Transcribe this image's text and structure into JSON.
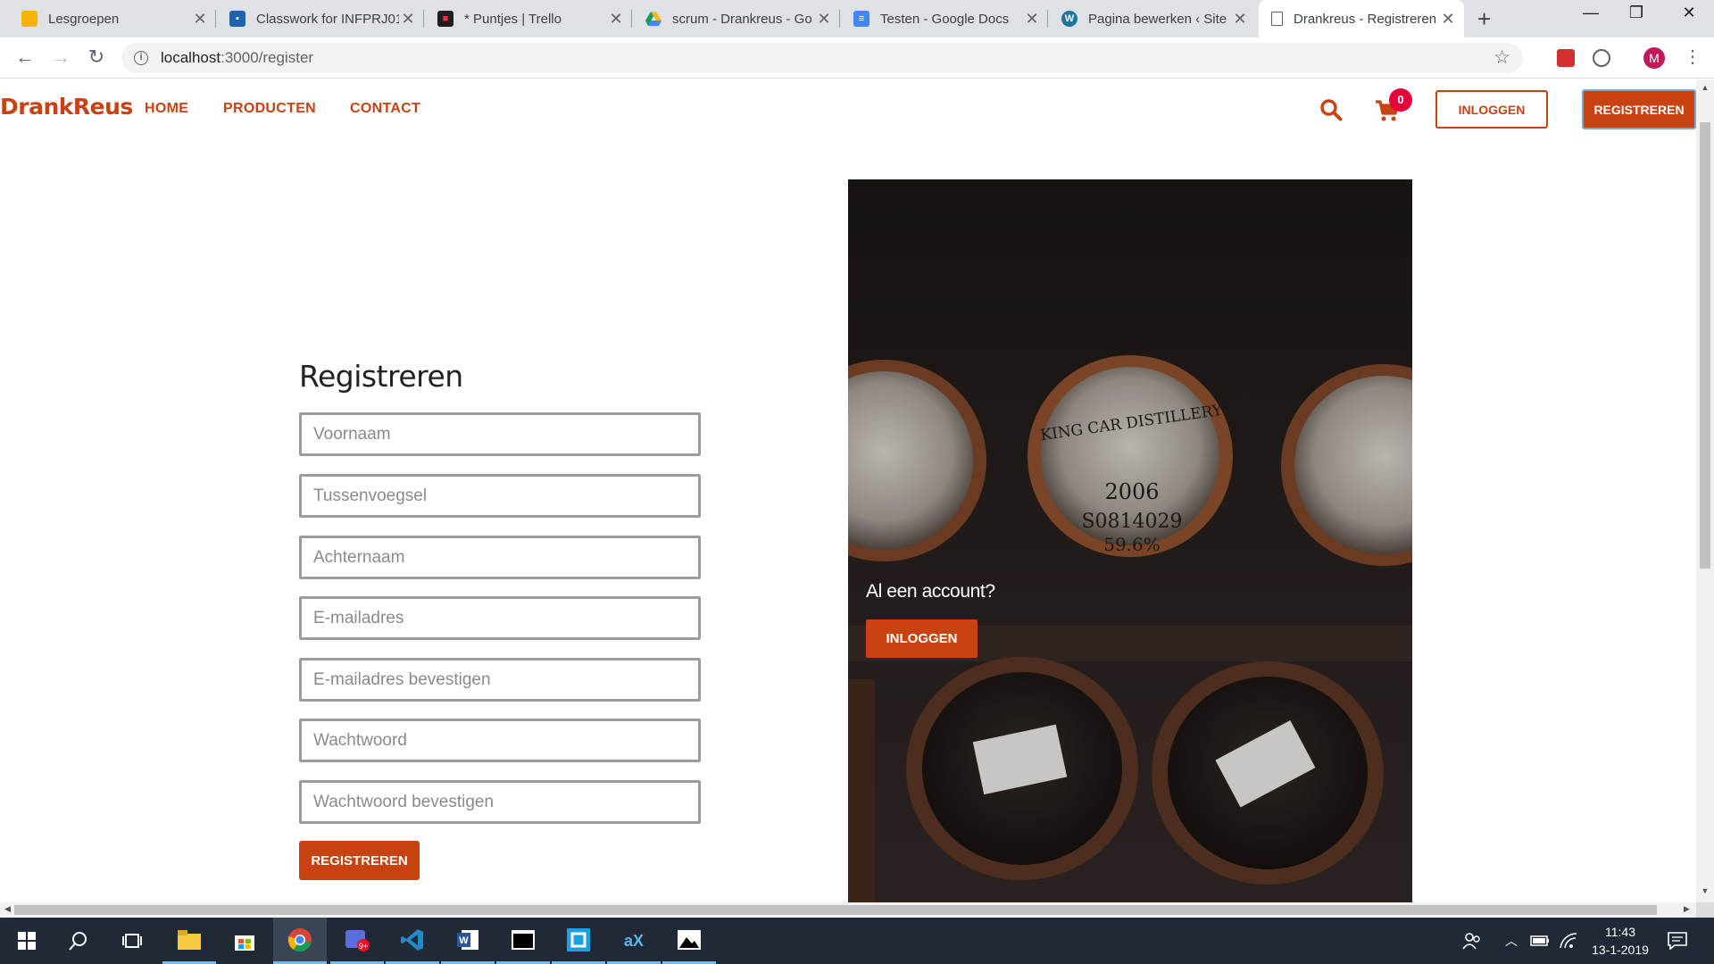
{
  "browser": {
    "tabs": [
      {
        "title": "Lesgroepen",
        "favicon_color": "#f4b400",
        "active": false
      },
      {
        "title": "Classwork for INFPRJ01",
        "favicon_color": "#1e63b0",
        "active": false
      },
      {
        "title": "* Puntjes | Trello",
        "favicon_color": "#1f1f1f",
        "active": false
      },
      {
        "title": "scrum - Drankreus - Go",
        "favicon_color": "#0f9d58",
        "active": false
      },
      {
        "title": "Testen - Google Docs",
        "favicon_color": "#4285f4",
        "active": false
      },
      {
        "title": "Pagina bewerken ‹ Site",
        "favicon_color": "#21759b",
        "active": false
      },
      {
        "title": "Drankreus - Registreren",
        "favicon_color": "#ffffff",
        "active": true
      }
    ],
    "url_host": "localhost",
    "url_path": ":3000/register",
    "profile_initial": "M"
  },
  "site": {
    "logo": "DrankReus",
    "nav": {
      "home": "HOME",
      "products": "PRODUCTEN",
      "contact": "CONTACT"
    },
    "cart_count": "0",
    "login_button": "INLOGGEN",
    "register_button": "REGISTREREN",
    "accent_color": "#c94212"
  },
  "form": {
    "title": "Registreren",
    "fields": [
      {
        "placeholder": "Voornaam"
      },
      {
        "placeholder": "Tussenvoegsel"
      },
      {
        "placeholder": "Achternaam"
      },
      {
        "placeholder": "E-mailadres"
      },
      {
        "placeholder": "E-mailadres bevestigen"
      },
      {
        "placeholder": "Wachtwoord"
      },
      {
        "placeholder": "Wachtwoord bevestigen"
      }
    ],
    "submit_label": "REGISTREREN"
  },
  "promo": {
    "question": "Al een account?",
    "button": "INLOGGEN",
    "barrel_texts": [
      "KING CAR DISTILLERY",
      "2006",
      "S0814029",
      "59.6%"
    ]
  },
  "taskbar": {
    "time": "11:43",
    "date": "13-1-2019",
    "chat_badge": "9+"
  }
}
